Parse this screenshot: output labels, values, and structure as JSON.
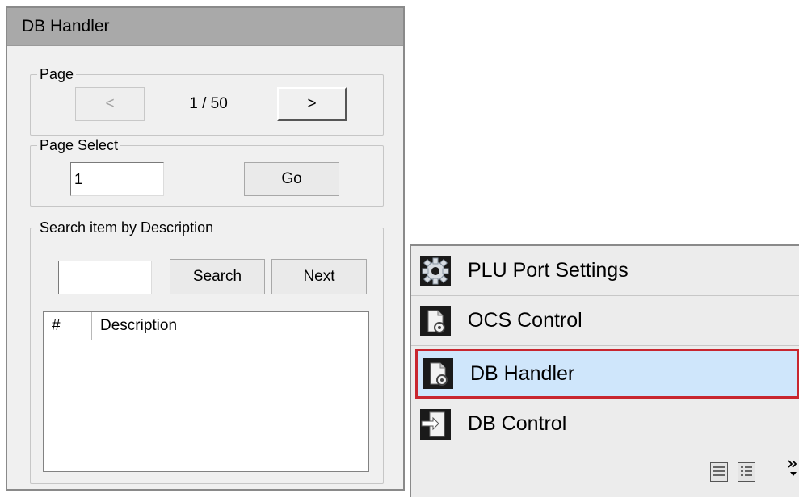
{
  "panel": {
    "title": "DB Handler",
    "page_group": {
      "legend": "Page",
      "prev_label": "<",
      "indicator": "1 / 50",
      "next_label": ">"
    },
    "page_select_group": {
      "legend": "Page Select",
      "input_value": "1",
      "go_label": "Go"
    },
    "search_group": {
      "legend": "Search item by Description",
      "search_input_value": "",
      "search_label": "Search",
      "next_label": "Next",
      "columns": [
        "#",
        "Description",
        ""
      ],
      "rows": []
    }
  },
  "nav": {
    "items": [
      {
        "label": "PLU Port Settings",
        "icon": "gear-icon",
        "selected": false
      },
      {
        "label": "OCS Control",
        "icon": "document-gear-icon",
        "selected": false
      },
      {
        "label": "DB Handler",
        "icon": "document-gear-icon",
        "selected": true
      },
      {
        "label": "DB Control",
        "icon": "document-arrow-icon",
        "selected": false
      }
    ],
    "footer_icons": [
      "large-view-icon",
      "list-view-icon",
      "overflow-chevron-icon"
    ],
    "colors": {
      "selected_background": "#cfe6fb",
      "selected_border": "#c8262f"
    }
  }
}
